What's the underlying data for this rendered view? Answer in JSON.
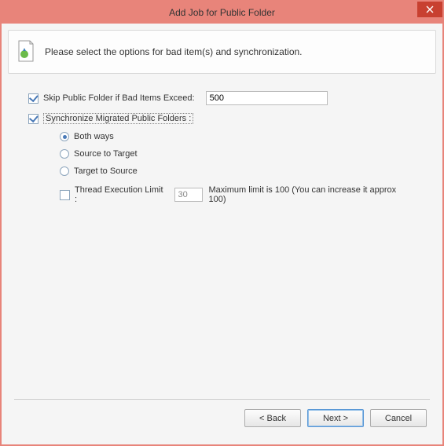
{
  "title": "Add Job for Public Folder",
  "banner": {
    "text": "Please select the options for bad item(s) and synchronization."
  },
  "options": {
    "skip": {
      "label": "Skip Public Folder if Bad Items Exceed:",
      "value": "500",
      "checked": true
    },
    "sync": {
      "label": "Synchronize Migrated Public Folders :",
      "checked": true
    },
    "radios": {
      "both": "Both ways",
      "s2t": "Source to Target",
      "t2s": "Target to Source",
      "selected": "both"
    },
    "thread": {
      "checked": false,
      "label": "Thread Execution Limit :",
      "value": "30",
      "hint": "Maximum limit is 100 (You can increase it approx 100)"
    }
  },
  "buttons": {
    "back": "< Back",
    "next": "Next >",
    "cancel": "Cancel"
  }
}
